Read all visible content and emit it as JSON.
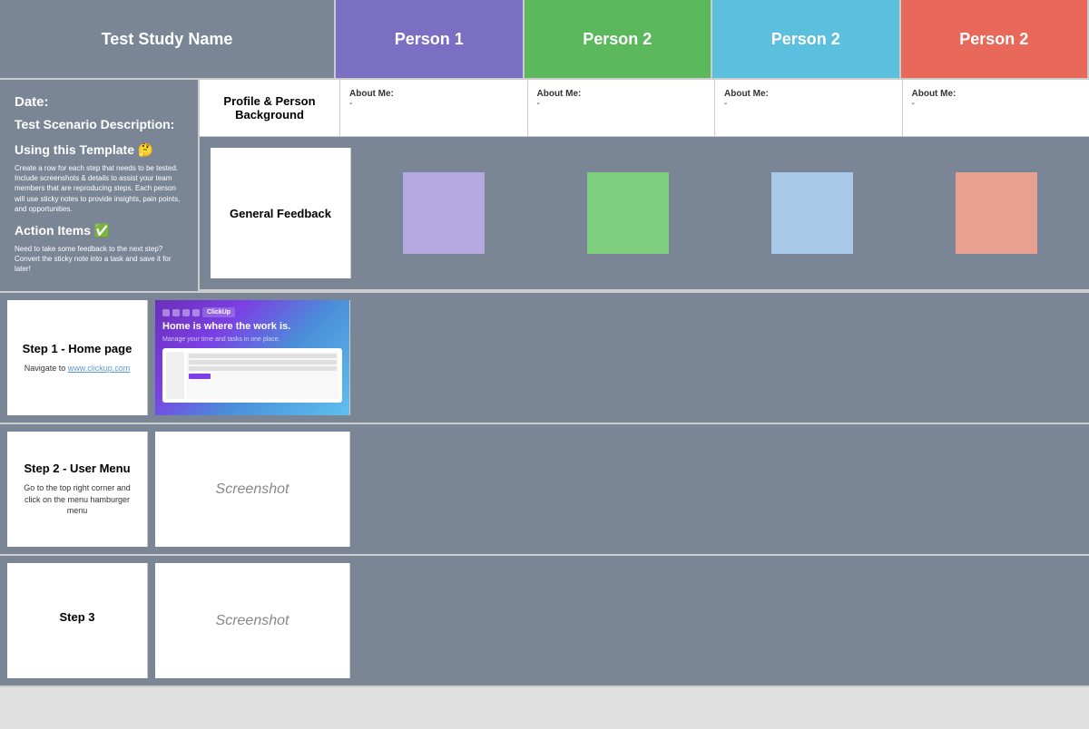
{
  "header": {
    "study_name": "Test Study Name",
    "person1_label": "Person 1",
    "person2a_label": "Person 2",
    "person2b_label": "Person 2",
    "person2c_label": "Person 2"
  },
  "info": {
    "date_label": "Date:",
    "scenario_label": "Test Scenario Description:",
    "using_label": "Using this Template 🤔",
    "using_text": "Create a row for each step that needs to be tested. Include screenshots & details to assist your team members that are reproducing steps. Each person will use sticky notes to provide insights, pain points, and opportunities.",
    "action_label": "Action Items ✅",
    "action_text": "Need to take some feedback to the next step? Convert the sticky note into a task and save it for later!"
  },
  "profile": {
    "header": "Profile & Person Background",
    "about_label": "About Me:",
    "persons": [
      {
        "about": "About Me:",
        "value": "-"
      },
      {
        "about": "About Me:",
        "value": "-"
      },
      {
        "about": "About Me:",
        "value": "-"
      },
      {
        "about": "About Me:",
        "value": "-"
      }
    ]
  },
  "feedback": {
    "label": "General Feedback"
  },
  "steps": [
    {
      "title": "Step 1 - Home page",
      "description": "Navigate to",
      "link": "www.clickup.com",
      "has_screenshot_image": true,
      "screenshot_placeholder": ""
    },
    {
      "title": "Step 2 - User Menu",
      "description": "Go to the top right corner and click on the menu hamburger menu",
      "link": "",
      "has_screenshot_image": false,
      "screenshot_placeholder": "Screenshot"
    },
    {
      "title": "Step 3",
      "description": "",
      "link": "",
      "has_screenshot_image": false,
      "screenshot_placeholder": "Screenshot"
    }
  ]
}
